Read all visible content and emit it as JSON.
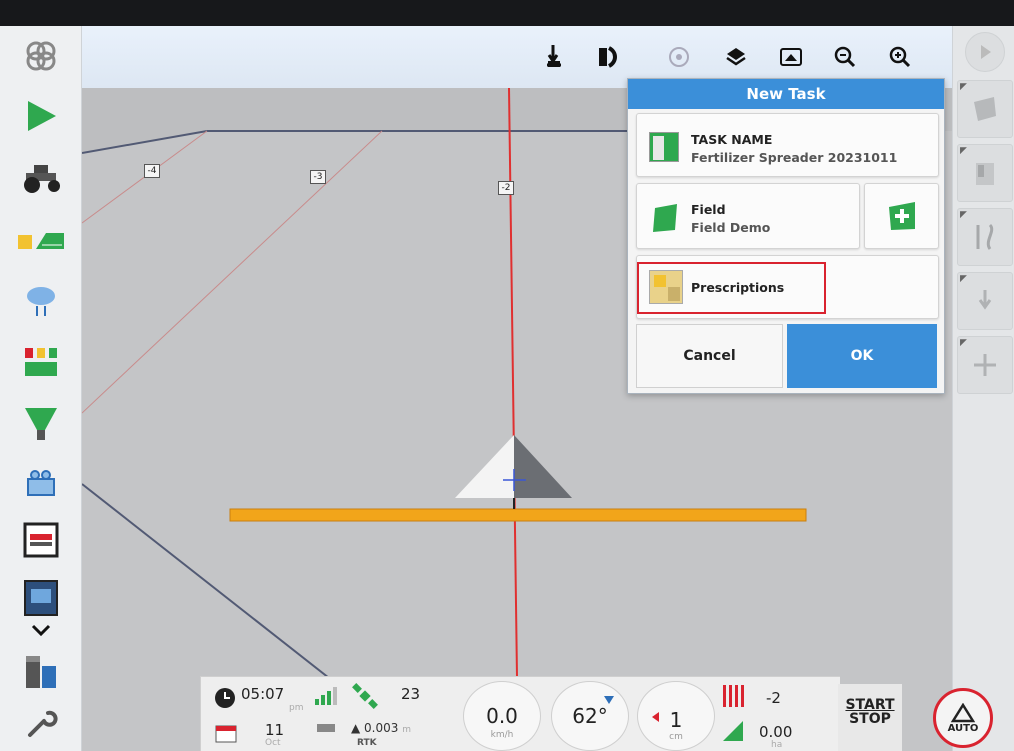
{
  "map": {
    "markers": [
      "-4",
      "-3",
      "-2"
    ]
  },
  "dialog": {
    "title": "New Task",
    "task_name_label": "TASK NAME",
    "task_name_value": "Fertilizer Spreader 20231011",
    "field_label": "Field",
    "field_value": "Field Demo",
    "prescriptions_label": "Prescriptions",
    "cancel_label": "Cancel",
    "ok_label": "OK"
  },
  "status": {
    "time": "05:07",
    "ampm": "pm",
    "date_day": "11",
    "date_month": "Oct",
    "satellites": "23",
    "accuracy": "0.003",
    "accuracy_unit": "m",
    "correction": "RTK",
    "speed": "0.0",
    "speed_unit": "km/h",
    "heading": "62°",
    "offset": "1",
    "offset_unit": "cm",
    "sections": "-2",
    "area": "0.00",
    "area_unit": "ha"
  },
  "controls": {
    "start_label": "START",
    "stop_label": "STOP",
    "auto_label": "AUTO"
  },
  "colors": {
    "accent": "#3b8fd9",
    "highlight": "#d9232f",
    "boom": "#f2a51a",
    "guidance": "#e03030",
    "green": "#2fa84f"
  }
}
